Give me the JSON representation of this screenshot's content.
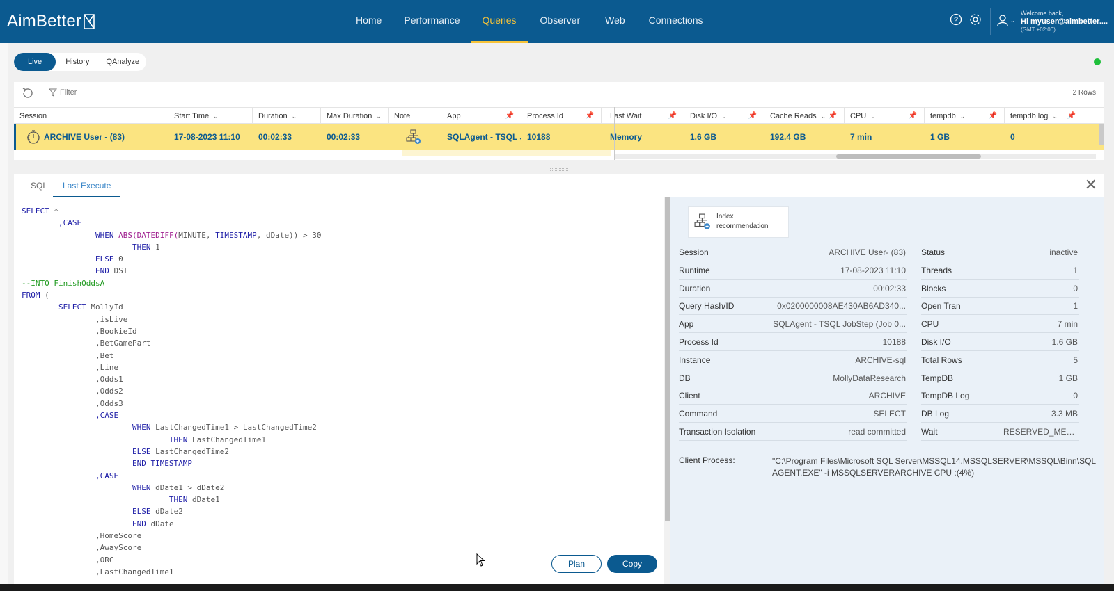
{
  "header": {
    "logo_text": "AimBetter",
    "nav": [
      "Home",
      "Performance",
      "Queries",
      "Observer",
      "Web",
      "Connections"
    ],
    "active_nav": "Queries",
    "welcome_line1": "Welcome back,",
    "welcome_line2": "Hi myuser@aimbetter....",
    "welcome_line3": "(GMT +02:00)"
  },
  "modes": {
    "live": "Live",
    "history": "History",
    "qanalyze": "QAnalyze"
  },
  "grid": {
    "filter_label": "Filter",
    "rows_count": "2 Rows",
    "columns": [
      "Session",
      "Start Time",
      "Duration",
      "Max Duration",
      "Note",
      "App",
      "Process Id",
      "Last Wait",
      "Disk I/O",
      "Cache Reads",
      "CPU",
      "tempdb",
      "tempdb log"
    ],
    "row": {
      "session": "ARCHIVE User - (83)",
      "start_time": "17-08-2023 11:10",
      "duration": "00:02:33",
      "max_duration": "00:02:33",
      "app": "SQLAgent - TSQL Jo",
      "process_id": "10188",
      "last_wait": "Memory",
      "disk_io": "1.6 GB",
      "cache_reads": "192.4 GB",
      "cpu": "7 min",
      "tempdb": "1 GB",
      "tempdb_log": "0"
    }
  },
  "detail": {
    "tab_sql": "SQL",
    "tab_last_execute": "Last Execute",
    "plan_label": "Plan",
    "copy_label": "Copy",
    "index_recommendation": "Index recommendation",
    "left_fields": [
      {
        "key": "Session",
        "value": "ARCHIVE User- (83)"
      },
      {
        "key": "Runtime",
        "value": "17-08-2023 11:10"
      },
      {
        "key": "Duration",
        "value": "00:02:33"
      },
      {
        "key": "Query Hash/ID",
        "value": "0x0200000008AE430AB6AD340..."
      },
      {
        "key": "App",
        "value": "SQLAgent - TSQL JobStep (Job 0..."
      },
      {
        "key": "Process Id",
        "value": "10188"
      },
      {
        "key": "Instance",
        "value": "ARCHIVE-sql"
      },
      {
        "key": "DB",
        "value": "MollyDataResearch"
      },
      {
        "key": "Client",
        "value": "ARCHIVE"
      },
      {
        "key": "Command",
        "value": "SELECT"
      },
      {
        "key": "Transaction Isolation",
        "value": "read committed"
      }
    ],
    "right_fields": [
      {
        "key": "Status",
        "value": "inactive"
      },
      {
        "key": "Threads",
        "value": "1"
      },
      {
        "key": "Blocks",
        "value": "0"
      },
      {
        "key": "Open Tran",
        "value": "1"
      },
      {
        "key": "CPU",
        "value": "7 min"
      },
      {
        "key": "Disk I/O",
        "value": "1.6 GB"
      },
      {
        "key": "Total Rows",
        "value": "5"
      },
      {
        "key": "TempDB",
        "value": "1 GB"
      },
      {
        "key": "TempDB Log",
        "value": "0"
      },
      {
        "key": "DB Log",
        "value": "3.3 MB"
      },
      {
        "key": "Wait",
        "value": "RESERVED_MEMORY..."
      }
    ],
    "client_process_label": "Client Process:",
    "client_process_value": "\"C:\\Program Files\\Microsoft SQL Server\\MSSQL14.MSSQLSERVER\\MSSQL\\Binn\\SQLAGENT.EXE\" -i MSSQLSERVERARCHIVE CPU :(4%)"
  },
  "sql_lines": [
    [
      [
        "kw",
        "SELECT"
      ],
      [
        "op",
        " *"
      ]
    ],
    [
      [
        "op",
        "        "
      ],
      [
        "kw",
        ",CASE"
      ]
    ],
    [
      [
        "op",
        "                "
      ],
      [
        "kw",
        "WHEN "
      ],
      [
        "fn",
        "ABS(DATEDIFF("
      ],
      [
        "op",
        "MINUTE, "
      ],
      [
        "kw",
        "TIMESTAMP"
      ],
      [
        "op",
        ", dDate)) > 30"
      ]
    ],
    [
      [
        "op",
        "                        "
      ],
      [
        "kw",
        "THEN "
      ],
      [
        "op",
        "1"
      ]
    ],
    [
      [
        "op",
        "                "
      ],
      [
        "kw",
        "ELSE "
      ],
      [
        "op",
        "0"
      ]
    ],
    [
      [
        "op",
        "                "
      ],
      [
        "kw",
        "END "
      ],
      [
        "op",
        "DST"
      ]
    ],
    [
      [
        "cm",
        "--INTO FinishOddsA"
      ]
    ],
    [
      [
        "kw",
        "FROM "
      ],
      [
        "op",
        "("
      ]
    ],
    [
      [
        "op",
        "        "
      ],
      [
        "kw",
        "SELECT "
      ],
      [
        "op",
        "MollyId"
      ]
    ],
    [
      [
        "op",
        "                ,isLive"
      ]
    ],
    [
      [
        "op",
        "                ,BookieId"
      ]
    ],
    [
      [
        "op",
        "                ,BetGamePart"
      ]
    ],
    [
      [
        "op",
        "                ,Bet"
      ]
    ],
    [
      [
        "op",
        "                ,Line"
      ]
    ],
    [
      [
        "op",
        "                ,Odds1"
      ]
    ],
    [
      [
        "op",
        "                ,Odds2"
      ]
    ],
    [
      [
        "op",
        "                ,Odds3"
      ]
    ],
    [
      [
        "op",
        "                "
      ],
      [
        "kw",
        ",CASE"
      ]
    ],
    [
      [
        "op",
        "                        "
      ],
      [
        "kw",
        "WHEN "
      ],
      [
        "op",
        "LastChangedTime1 > LastChangedTime2"
      ]
    ],
    [
      [
        "op",
        "                                "
      ],
      [
        "kw",
        "THEN "
      ],
      [
        "op",
        "LastChangedTime1"
      ]
    ],
    [
      [
        "op",
        "                        "
      ],
      [
        "kw",
        "ELSE "
      ],
      [
        "op",
        "LastChangedTime2"
      ]
    ],
    [
      [
        "op",
        "                        "
      ],
      [
        "kw",
        "END TIMESTAMP"
      ]
    ],
    [
      [
        "op",
        "                "
      ],
      [
        "kw",
        ",CASE"
      ]
    ],
    [
      [
        "op",
        "                        "
      ],
      [
        "kw",
        "WHEN "
      ],
      [
        "op",
        "dDate1 > dDate2"
      ]
    ],
    [
      [
        "op",
        "                                "
      ],
      [
        "kw",
        "THEN "
      ],
      [
        "op",
        "dDate1"
      ]
    ],
    [
      [
        "op",
        "                        "
      ],
      [
        "kw",
        "ELSE "
      ],
      [
        "op",
        "dDate2"
      ]
    ],
    [
      [
        "op",
        "                        "
      ],
      [
        "kw",
        "END "
      ],
      [
        "op",
        "dDate"
      ]
    ],
    [
      [
        "op",
        "                ,HomeScore"
      ]
    ],
    [
      [
        "op",
        "                ,AwayScore"
      ]
    ],
    [
      [
        "op",
        "                ,ORC"
      ]
    ],
    [
      [
        "op",
        "                ,LastChangedTime1"
      ]
    ]
  ]
}
